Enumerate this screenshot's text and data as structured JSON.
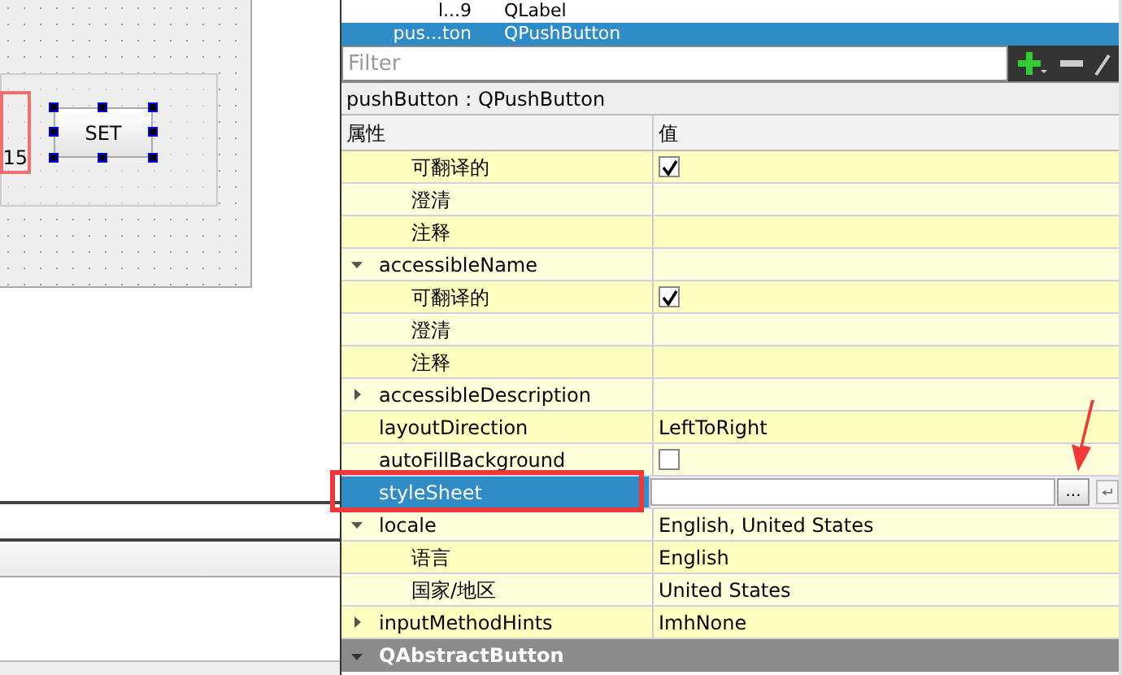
{
  "designer": {
    "button_label": "SET",
    "partial_widget_text": "15"
  },
  "object_list": [
    {
      "name": "l...9",
      "class": "QLabel",
      "selected": false
    },
    {
      "name": "pus...ton",
      "class": "QPushButton",
      "selected": true
    }
  ],
  "filter": {
    "placeholder": "Filter"
  },
  "object_title": "pushButton : QPushButton",
  "columns": [
    "属性",
    "值"
  ],
  "properties": [
    {
      "children": [
        {
          "name": "可翻译的",
          "kind": "checkbox",
          "checked": true,
          "selected": false
        },
        {
          "name": "澄清",
          "kind": "text",
          "selected": false
        },
        {
          "name": "注释",
          "kind": "text",
          "selected": false
        }
      ]
    },
    {
      "name": "accessibleName",
      "kind": "text",
      "selected": false,
      "expanded": true,
      "children": [
        {
          "name": "可翻译的",
          "kind": "checkbox",
          "checked": true,
          "selected": false
        },
        {
          "name": "澄清",
          "kind": "text",
          "selected": false
        },
        {
          "name": "注释",
          "kind": "text",
          "selected": false
        }
      ]
    },
    {
      "name": "accessibleDescription",
      "kind": "text",
      "selected": false,
      "expanded": false
    },
    {
      "name": "layoutDirection",
      "kind": "text",
      "value": "LeftToRight",
      "selected": false
    },
    {
      "name": "autoFillBackground",
      "kind": "checkbox",
      "checked": false,
      "selected": false
    },
    {
      "name": "styleSheet",
      "kind": "editor",
      "selected": true,
      "button_label": "..."
    },
    {
      "name": "locale",
      "kind": "text",
      "value": "English, United States",
      "selected": false,
      "expanded": true,
      "children": [
        {
          "name": "语言",
          "kind": "text",
          "value": "English",
          "selected": false
        },
        {
          "name": "国家/地区",
          "kind": "text",
          "value": "United States",
          "selected": false
        }
      ]
    },
    {
      "name": "inputMethodHints",
      "kind": "text",
      "value": "ImhNone",
      "selected": false,
      "expanded": false
    }
  ],
  "category": {
    "name": "QAbstractButton",
    "expanded": true
  }
}
